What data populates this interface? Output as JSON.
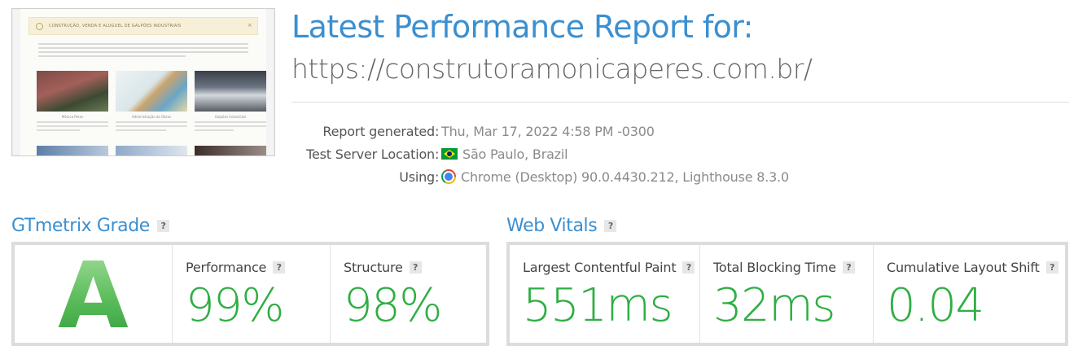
{
  "thumbnail": {
    "banner_text": "CONSTRUÇÃO, VENDA E ALUGUEL DE GALPÕES INDUSTRIAIS",
    "banner_close": "×",
    "captions": [
      "Mônica Peres",
      "Administração de Obras",
      "Galpões Industriais"
    ]
  },
  "header": {
    "title": "Latest Performance Report for:",
    "url": "https://construtoramonicaperes.com.br/"
  },
  "meta": {
    "report_generated_label": "Report generated",
    "report_generated_value": "Thu, Mar 17, 2022 4:58 PM -0300",
    "location_label": "Test Server Location",
    "location_value": "São Paulo, Brazil",
    "location_icon": "brazil-flag-icon",
    "using_label": "Using",
    "using_value": "Chrome (Desktop) 90.0.4430.212, Lighthouse 8.3.0",
    "using_icon": "chrome-icon",
    "colon": ":"
  },
  "gtmetrix": {
    "title": "GTmetrix Grade",
    "help": "?",
    "grade": "A",
    "performance_label": "Performance",
    "performance_value": "99%",
    "structure_label": "Structure",
    "structure_value": "98%"
  },
  "web_vitals": {
    "title": "Web Vitals",
    "help": "?",
    "lcp_label": "Largest Contentful Paint",
    "lcp_value": "551ms",
    "tbt_label": "Total Blocking Time",
    "tbt_value": "32ms",
    "cls_label": "Cumulative Layout Shift",
    "cls_value": "0.04"
  },
  "colors": {
    "accent_blue": "#3b8fd0",
    "good_green": "#2fae43"
  }
}
